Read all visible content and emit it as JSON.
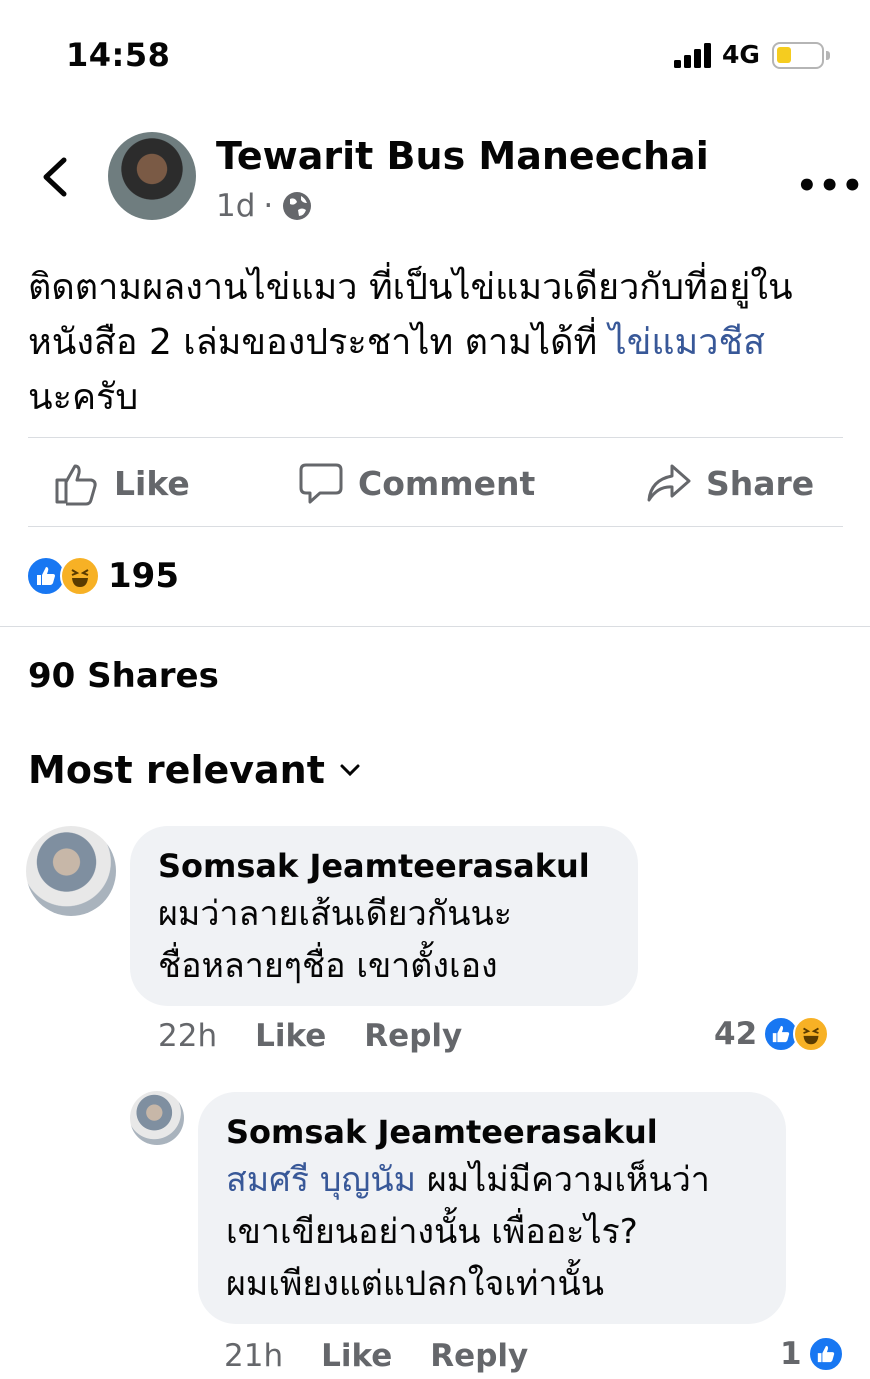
{
  "status_bar": {
    "time": "14:58",
    "network": "4G",
    "battery_level": 0.25,
    "battery_color": "#f5cc1f"
  },
  "post": {
    "author": "Tewarit Bus Maneechai",
    "age": "1d",
    "separator": "·",
    "privacy_icon": "globe-icon",
    "text_line1": "ติดตามผลงานไข่แมว ที่เป็นไข่แมวเดียวกับที่อยู่ใน",
    "text_line2_prefix": "หนังสือ 2 เล่มของประชาไท ตามได้ที่ ",
    "text_link": "ไข่แมวชีส",
    "text_line3": "นะครับ",
    "more_label": "•••"
  },
  "actions": {
    "like": "Like",
    "comment": "Comment",
    "share": "Share"
  },
  "reactions": {
    "icons": [
      "like-icon",
      "haha-icon"
    ],
    "count": "195"
  },
  "shares_label": "90 Shares",
  "sort_label": "Most relevant",
  "comments": [
    {
      "name": "Somsak Jeamteerasakul",
      "line1": "ผมว่าลายเส้นเดียวกันนะ",
      "line2": "ชื่อหลายๆชื่อ เขาตั้งเอง",
      "time": "22h",
      "like": "Like",
      "reply": "Reply",
      "reaction_count": "42",
      "reaction_icons": [
        "like-icon",
        "haha-icon"
      ]
    },
    {
      "name": "Somsak Jeamteerasakul",
      "mention": "สมศรี บุญนัม",
      "line1_rest": " ผมไม่มีความเห็นว่า",
      "line2": "เขาเขียนอย่างนั้น เพื่ออะไร?",
      "line3": "ผมเพียงแต่แปลกใจเท่านั้น",
      "time": "21h",
      "like": "Like",
      "reply": "Reply",
      "reaction_count": "1",
      "reaction_icons": [
        "like-icon"
      ]
    }
  ],
  "colors": {
    "link": "#385898",
    "secondary_text": "#65676b",
    "bubble": "#f0f2f5",
    "like_blue": "#1877f2",
    "haha_yellow": "#f7b125"
  }
}
